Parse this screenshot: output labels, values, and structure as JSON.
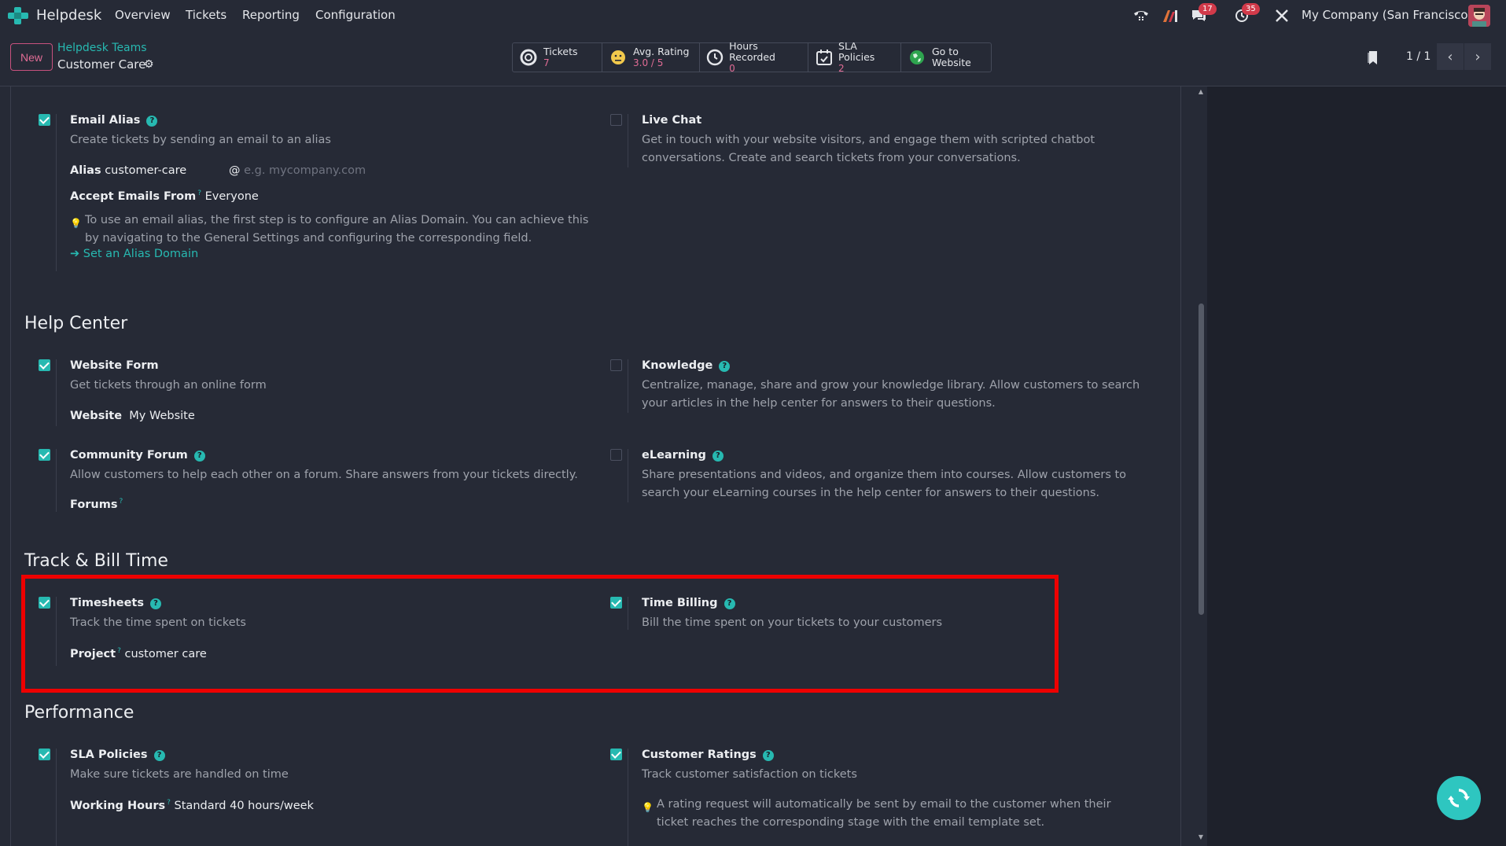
{
  "navbar": {
    "app_name": "Helpdesk",
    "menu": [
      "Overview",
      "Tickets",
      "Reporting",
      "Configuration"
    ],
    "chat_count": "17",
    "activity_count": "35",
    "company": "My Company (San Francisco)"
  },
  "control": {
    "new_label": "New",
    "breadcrumb_parent": "Helpdesk Teams",
    "breadcrumb_current": "Customer Care",
    "stats": [
      {
        "label": "Tickets",
        "value": "7",
        "icon": "lifebuoy-icon"
      },
      {
        "label": "Avg. Rating",
        "value": "3.0 / 5",
        "icon": "smiley-icon"
      },
      {
        "label": "Hours Recorded",
        "value": "0",
        "icon": "clock-icon"
      },
      {
        "label": "SLA Policies",
        "value": "2",
        "icon": "calendar-check-icon"
      },
      {
        "label": "Go to",
        "value": "Website",
        "icon": "globe-icon"
      }
    ],
    "pager": "1 / 1"
  },
  "channels": {
    "email_alias": {
      "title": "Email Alias",
      "desc": "Create tickets by sending an email to an alias",
      "alias_label": "Alias",
      "alias_value": "customer-care",
      "alias_domain_placeholder": "e.g. mycompany.com",
      "accept_label": "Accept Emails From",
      "accept_value": "Everyone",
      "note": "To use an email alias, the first step is to configure an Alias Domain. You can achieve this by navigating to the General Settings and configuring the corresponding field.",
      "link": "Set an Alias Domain"
    },
    "live_chat": {
      "title": "Live Chat",
      "desc": "Get in touch with your website visitors, and engage them with scripted chatbot conversations. Create and search tickets from your conversations."
    }
  },
  "help_center": {
    "title": "Help Center",
    "website_form": {
      "title": "Website Form",
      "desc": "Get tickets through an online form",
      "website_label": "Website",
      "website_value": "My Website"
    },
    "knowledge": {
      "title": "Knowledge",
      "desc": "Centralize, manage, share and grow your knowledge library. Allow customers to search your articles in the help center for answers to their questions."
    },
    "community_forum": {
      "title": "Community Forum",
      "desc": "Allow customers to help each other on a forum. Share answers from your tickets directly.",
      "forums_label": "Forums"
    },
    "elearning": {
      "title": "eLearning",
      "desc": "Share presentations and videos, and organize them into courses. Allow customers to search your eLearning courses in the help center for answers to their questions."
    }
  },
  "track_bill": {
    "title": "Track & Bill Time",
    "timesheets": {
      "title": "Timesheets",
      "desc": "Track the time spent on tickets",
      "project_label": "Project",
      "project_value": "customer care"
    },
    "time_billing": {
      "title": "Time Billing",
      "desc": "Bill the time spent on your tickets to your customers"
    }
  },
  "performance": {
    "title": "Performance",
    "sla": {
      "title": "SLA Policies",
      "desc": "Make sure tickets are handled on time",
      "hours_label": "Working Hours",
      "hours_value": "Standard 40 hours/week"
    },
    "ratings": {
      "title": "Customer Ratings",
      "desc": "Track customer satisfaction on tickets",
      "note": "A rating request will automatically be sent by email to the customer when their ticket reaches the corresponding stage with the email template set."
    }
  },
  "colors": {
    "accent": "#27b9b1",
    "highlight": "#ee0000",
    "stat_value": "#e06c95"
  }
}
